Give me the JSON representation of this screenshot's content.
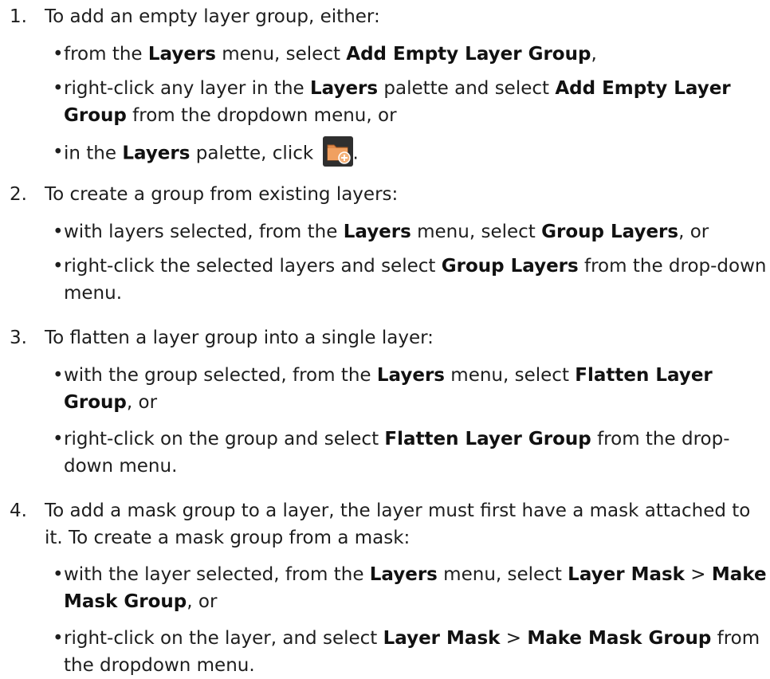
{
  "steps": [
    {
      "number": "1.",
      "lead": "To add an empty layer group, either:",
      "bullets": [
        {
          "t1": "from the ",
          "b1": "Layers",
          "t2": " menu, select ",
          "b2": "Add Empty Layer Group",
          "t3": ","
        },
        {
          "t1": "right-click any layer in the ",
          "b1": "Layers",
          "t2": " palette and select ",
          "b2": "Add Empty Layer Group",
          "t3": " from the dropdown menu, or"
        },
        {
          "t1": "in the ",
          "b1": "Layers",
          "t2": " palette, click ",
          "t3": "."
        }
      ]
    },
    {
      "number": "2.",
      "lead": "To create a group from existing layers:",
      "bullets": [
        {
          "t1": "with layers selected, from the ",
          "b1": "Layers",
          "t2": " menu, select ",
          "b2": "Group Layers",
          "t3": ", or"
        },
        {
          "t1": "right-click the selected layers and select ",
          "b1": "Group Layers",
          "t2": " from the drop-down menu."
        }
      ]
    },
    {
      "number": "3.",
      "lead": "To flatten a layer group into a single layer:",
      "bullets": [
        {
          "t1": "with the group selected, from the ",
          "b1": "Layers",
          "t2": " menu, select ",
          "b2": "Flatten Layer Group",
          "t3": ", or"
        },
        {
          "t1": "right-click on the group and select ",
          "b1": "Flatten Layer Group",
          "t2": " from the drop-down menu."
        }
      ]
    },
    {
      "number": "4.",
      "lead": "To add a mask group to a layer, the layer must first have a mask attached to it. To create a mask group from a mask:",
      "bullets": [
        {
          "t1": "with the layer selected, from the ",
          "b1": "Layers",
          "t2": " menu, select ",
          "b2": "Layer Mask",
          "t3": " > ",
          "b3": "Make Mask Group",
          "t4": ", or"
        },
        {
          "t1": "right-click on the layer, and select ",
          "b1": "Layer Mask",
          "t2": " > ",
          "b2": "Make Mask Group",
          "t3": " from the dropdown menu."
        }
      ]
    }
  ],
  "bullet_char": "•",
  "icons": {
    "add_group": "folder-add-icon"
  },
  "colors": {
    "icon_bg": "#2f2f2f",
    "folder": "#e0894a",
    "plus_badge": "#f0a060"
  }
}
